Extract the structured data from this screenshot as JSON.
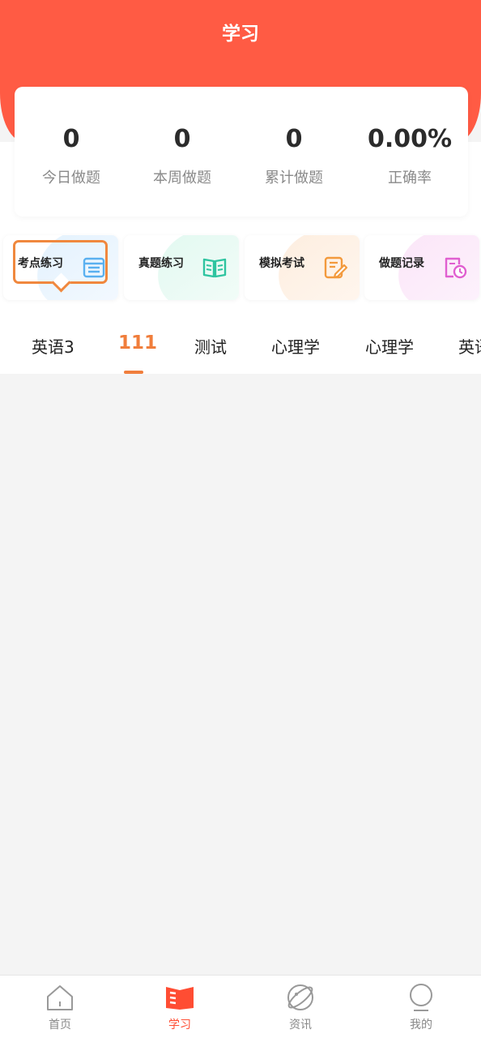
{
  "header": {
    "title": "学习"
  },
  "stats": [
    {
      "value": "0",
      "label": "今日做题"
    },
    {
      "value": "0",
      "label": "本周做题"
    },
    {
      "value": "0",
      "label": "累计做题"
    },
    {
      "value": "0.00%",
      "label": "正确率"
    }
  ],
  "features": [
    {
      "label": "考点练习",
      "icon": "calendar-list-icon",
      "color": "#5ab0f0"
    },
    {
      "label": "真题练习",
      "icon": "open-book-icon",
      "color": "#2ec4a0"
    },
    {
      "label": "模拟考试",
      "icon": "edit-paper-icon",
      "color": "#f39a3d"
    },
    {
      "label": "做题记录",
      "icon": "history-doc-icon",
      "color": "#e05fd0"
    }
  ],
  "tabs": [
    "英语3",
    "111",
    "测试",
    "心理学",
    "心理学",
    "英语"
  ],
  "active_tab": "111",
  "bottom_nav": [
    {
      "label": "首页",
      "icon": "home-icon"
    },
    {
      "label": "学习",
      "icon": "study-book-icon",
      "active": true
    },
    {
      "label": "资讯",
      "icon": "news-planet-icon"
    },
    {
      "label": "我的",
      "icon": "profile-icon"
    }
  ],
  "colors": {
    "brand": "#ff5b44",
    "accent": "#f07e3c"
  }
}
